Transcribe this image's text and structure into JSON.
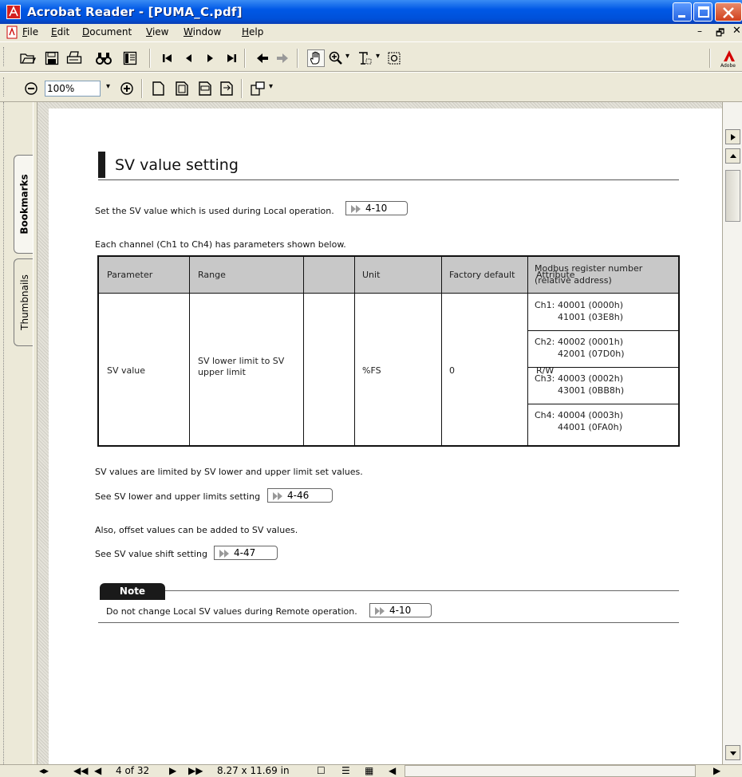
{
  "window": {
    "title": "Acrobat Reader - [PUMA_C.pdf]",
    "controls": {
      "minimize": "minimize",
      "maximize": "maximize",
      "close": "close"
    }
  },
  "menu": {
    "items": [
      "File",
      "Edit",
      "Document",
      "View",
      "Window",
      "Help"
    ]
  },
  "toolbar1": {
    "icons": [
      "open-icon",
      "save-icon",
      "print-icon",
      "find-icon",
      "show-hide-navigation-pane-icon",
      "first-page-icon",
      "previous-page-icon",
      "next-page-icon",
      "last-page-icon",
      "go-back-icon",
      "go-forward-icon",
      "hand-tool-icon",
      "zoom-in-tool-icon",
      "text-select-tool-icon",
      "graphics-select-tool-icon",
      "adobe-logo-icon"
    ]
  },
  "toolbar2": {
    "zoom_value": "100%",
    "icons": [
      "zoom-out-icon",
      "zoom-dropdown-icon",
      "zoom-in-icon",
      "actual-size-icon",
      "fit-page-icon",
      "fit-width-icon",
      "fit-visible-icon",
      "rotate-view-icon"
    ]
  },
  "nav_tabs": {
    "bookmarks": "Bookmarks",
    "thumbnails": "Thumbnails"
  },
  "document": {
    "section_title": "SV value setting",
    "intro_line": "Set the SV value which is used during Local operation.",
    "intro_ref": "4-10",
    "channel_line": "Each channel (Ch1 to Ch4) has parameters shown below.",
    "table": {
      "headers": [
        "Parameter",
        "Range",
        "Unit",
        "Factory default",
        "Attribute",
        "Modbus register number",
        "(relative address)"
      ],
      "row": {
        "parameter": "SV value",
        "range_line1": "SV lower limit to SV",
        "range_line2": "upper limit",
        "unit": "%FS",
        "factory_default": "0",
        "attribute": "R/W"
      },
      "modbus": [
        {
          "label": "Ch1:",
          "line1": "40001 (0000h)",
          "line2": "41001 (03E8h)"
        },
        {
          "label": "Ch2:",
          "line1": "40002 (0001h)",
          "line2": "42001 (07D0h)"
        },
        {
          "label": "Ch3:",
          "line1": "40003 (0002h)",
          "line2": "43001 (0BB8h)"
        },
        {
          "label": "Ch4:",
          "line1": "40004 (0003h)",
          "line2": "44001 (0FA0h)"
        }
      ]
    },
    "limit_line": "SV values are limited by SV lower and upper limit set values.",
    "limit_ref_line": "See SV lower and upper limits setting",
    "limit_ref": "4-46",
    "offset_line": "Also, offset values can be added to SV values.",
    "shift_ref_line": "See SV value shift setting",
    "shift_ref": "4-47",
    "note_label": "Note",
    "note_text": "Do not change Local SV values during Remote operation.",
    "note_ref": "4-10"
  },
  "statusbar": {
    "page_display": "4 of 32",
    "page_size": "8.27 x 11.69 in"
  }
}
